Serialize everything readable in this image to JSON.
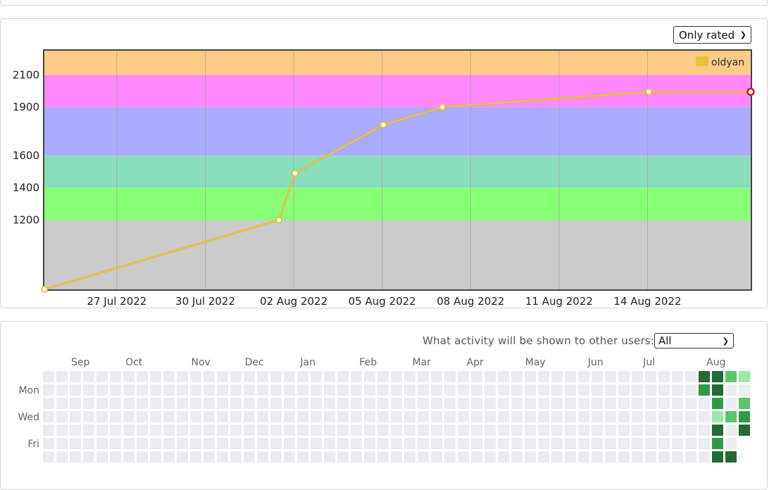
{
  "rating_panel": {
    "filter": {
      "selected": "Only rated",
      "icon": "chevron-down-icon"
    }
  },
  "chart_data": {
    "type": "line",
    "x_tick_labels": [
      "27 Jul 2022",
      "30 Jul 2022",
      "02 Aug 2022",
      "05 Aug 2022",
      "08 Aug 2022",
      "11 Aug 2022",
      "14 Aug 2022"
    ],
    "y_tick_labels": [
      "1200",
      "1400",
      "1600",
      "1900",
      "2100"
    ],
    "xlim": [
      "2022-07-24T13:00",
      "2022-08-17T12:00"
    ],
    "ylim": [
      770,
      2250
    ],
    "grid": true,
    "legend_position": "top-right",
    "rating_bands": [
      {
        "from": 770,
        "to": 1200,
        "color": "#cccccc"
      },
      {
        "from": 1200,
        "to": 1400,
        "color": "#88ff77"
      },
      {
        "from": 1400,
        "to": 1600,
        "color": "#88ddbb"
      },
      {
        "from": 1600,
        "to": 1900,
        "color": "#aaaaff"
      },
      {
        "from": 1900,
        "to": 2100,
        "color": "#ff88ff"
      },
      {
        "from": 2100,
        "to": 2250,
        "color": "#ffcc88"
      }
    ],
    "series": [
      {
        "name": "oldyan",
        "color": "#e8c23c",
        "points": [
          {
            "x": "2022-07-24T13:00",
            "y": 770
          },
          {
            "x": "2022-08-01T12:00",
            "y": 1200
          },
          {
            "x": "2022-08-02T01:00",
            "y": 1490
          },
          {
            "x": "2022-08-05T01:00",
            "y": 1790
          },
          {
            "x": "2022-08-07T01:00",
            "y": 1900
          },
          {
            "x": "2022-08-14T01:00",
            "y": 1995
          },
          {
            "x": "2022-08-17T12:00",
            "y": 1995
          }
        ]
      }
    ]
  },
  "activity_panel": {
    "label": "What activity will be shown to other users:",
    "visibility": {
      "selected": "All",
      "icon": "chevron-down-icon"
    },
    "months": [
      "Sep",
      "Oct",
      "Nov",
      "Dec",
      "Jan",
      "Feb",
      "Mar",
      "Apr",
      "May",
      "Jun",
      "Jul",
      "Aug"
    ],
    "weekdays": [
      "Mon",
      "Wed",
      "Fri"
    ],
    "colors": {
      "empty": "#ebedf0",
      "level1": "#9be9a8",
      "level2": "#5cc36a",
      "level3": "#2f9b46",
      "level4": "#226b35"
    },
    "recent_weeks": [
      [
        4,
        3,
        0,
        0,
        0,
        0,
        0
      ],
      [
        4,
        4,
        3,
        1,
        4,
        3,
        4
      ],
      [
        2,
        0,
        0,
        2,
        0,
        0,
        4
      ],
      [
        1,
        0,
        2,
        3,
        4,
        null,
        null
      ]
    ]
  }
}
